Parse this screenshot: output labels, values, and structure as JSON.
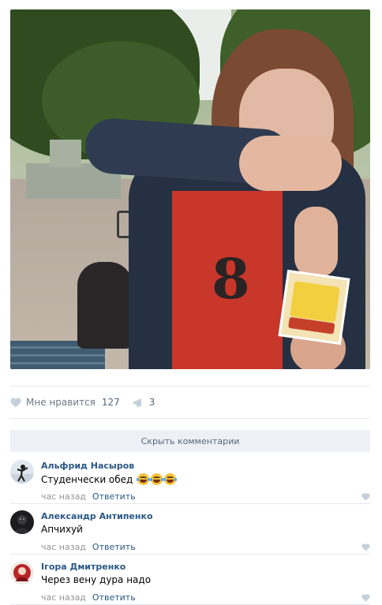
{
  "post": {
    "photo_description_icon": "photo",
    "likes": {
      "label": "Мне нравится",
      "count": "127"
    },
    "shares": {
      "count": "3"
    }
  },
  "comments_section": {
    "hide_label": "Скрыть комментарии",
    "items": [
      {
        "author": "Альфрид Насыров",
        "text": "Студенчески обед",
        "emoji_count": 3,
        "time": "час назад",
        "reply_label": "Ответить"
      },
      {
        "author": "Александр Антипенко",
        "text": "Апчихуй",
        "time": "час назад",
        "reply_label": "Ответить"
      },
      {
        "author": "Ігора Дмитренко",
        "text": "Через вену дура надо",
        "time": "час назад",
        "reply_label": "Ответить"
      }
    ]
  },
  "colors": {
    "link": "#2a5885",
    "muted": "#939393",
    "action_gray": "#6d7985",
    "hide_bar_bg": "#edf0f5"
  }
}
